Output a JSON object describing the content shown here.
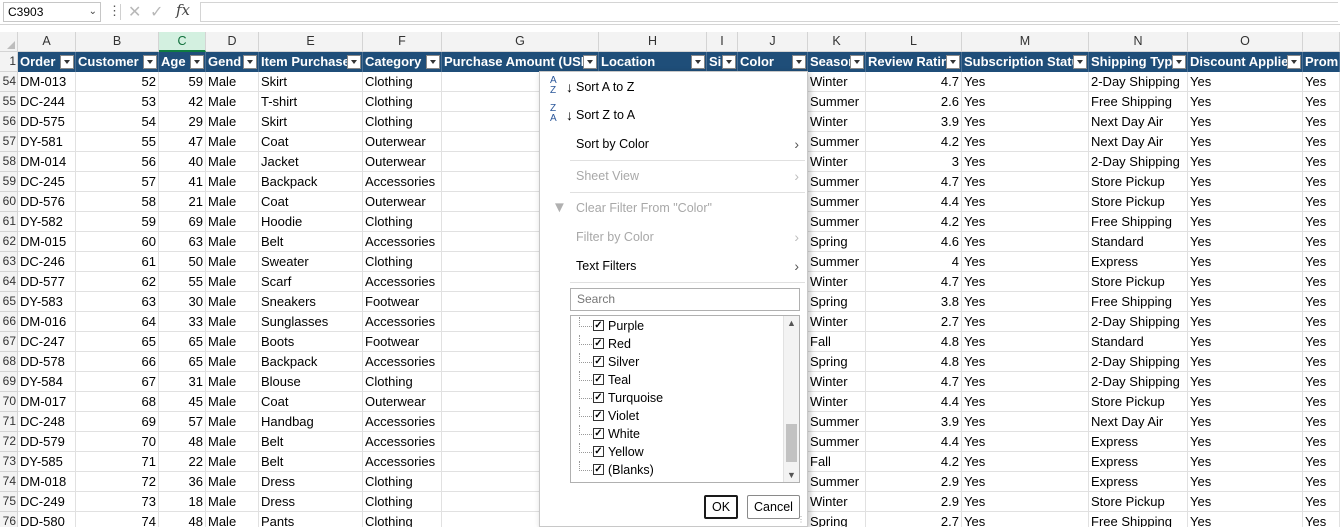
{
  "formula_bar": {
    "name_box": "C3903",
    "fx_label": "fx",
    "formula": ""
  },
  "columns": [
    "A",
    "B",
    "C",
    "D",
    "E",
    "F",
    "G",
    "H",
    "I",
    "J",
    "K",
    "L",
    "M",
    "N",
    "O",
    ""
  ],
  "selected_column": "C",
  "headers": [
    "Order",
    "Customer",
    "Age",
    "Gend",
    "Item Purchase",
    "Category",
    "Purchase Amount (USD)",
    "Location",
    "Si",
    "Color",
    "Season",
    "Review Rating",
    "Subscription Status",
    "Shipping Type",
    "Discount Applied",
    "Prom"
  ],
  "header_row_number": "1",
  "rows": [
    {
      "row": "54",
      "id": "DM-013",
      "cust": "52",
      "age": "59",
      "gender": "Male",
      "item": "Skirt",
      "category": "Clothing",
      "season": "Winter",
      "rating": "4.7",
      "sub": "Yes",
      "ship": "2-Day Shipping",
      "disc": "Yes",
      "promo": "Yes"
    },
    {
      "row": "55",
      "id": "DC-244",
      "cust": "53",
      "age": "42",
      "gender": "Male",
      "item": "T-shirt",
      "category": "Clothing",
      "season": "Summer",
      "rating": "2.6",
      "sub": "Yes",
      "ship": "Free Shipping",
      "disc": "Yes",
      "promo": "Yes"
    },
    {
      "row": "56",
      "id": "DD-575",
      "cust": "54",
      "age": "29",
      "gender": "Male",
      "item": "Skirt",
      "category": "Clothing",
      "season": "Winter",
      "rating": "3.9",
      "sub": "Yes",
      "ship": "Next Day Air",
      "disc": "Yes",
      "promo": "Yes"
    },
    {
      "row": "57",
      "id": "DY-581",
      "cust": "55",
      "age": "47",
      "gender": "Male",
      "item": "Coat",
      "category": "Outerwear",
      "season": "Summer",
      "rating": "4.2",
      "sub": "Yes",
      "ship": "Next Day Air",
      "disc": "Yes",
      "promo": "Yes"
    },
    {
      "row": "58",
      "id": "DM-014",
      "cust": "56",
      "age": "40",
      "gender": "Male",
      "item": "Jacket",
      "category": "Outerwear",
      "season": "Winter",
      "rating": "3",
      "sub": "Yes",
      "ship": "2-Day Shipping",
      "disc": "Yes",
      "promo": "Yes"
    },
    {
      "row": "59",
      "id": "DC-245",
      "cust": "57",
      "age": "41",
      "gender": "Male",
      "item": "Backpack",
      "category": "Accessories",
      "season": "Summer",
      "rating": "4.7",
      "sub": "Yes",
      "ship": "Store Pickup",
      "disc": "Yes",
      "promo": "Yes"
    },
    {
      "row": "60",
      "id": "DD-576",
      "cust": "58",
      "age": "21",
      "gender": "Male",
      "item": "Coat",
      "category": "Outerwear",
      "season": "Summer",
      "rating": "4.4",
      "sub": "Yes",
      "ship": "Store Pickup",
      "disc": "Yes",
      "promo": "Yes"
    },
    {
      "row": "61",
      "id": "DY-582",
      "cust": "59",
      "age": "69",
      "gender": "Male",
      "item": "Hoodie",
      "category": "Clothing",
      "season": "Summer",
      "rating": "4.2",
      "sub": "Yes",
      "ship": "Free Shipping",
      "disc": "Yes",
      "promo": "Yes"
    },
    {
      "row": "62",
      "id": "DM-015",
      "cust": "60",
      "age": "63",
      "gender": "Male",
      "item": "Belt",
      "category": "Accessories",
      "season": "Spring",
      "rating": "4.6",
      "sub": "Yes",
      "ship": "Standard",
      "disc": "Yes",
      "promo": "Yes"
    },
    {
      "row": "63",
      "id": "DC-246",
      "cust": "61",
      "age": "50",
      "gender": "Male",
      "item": "Sweater",
      "category": "Clothing",
      "season": "Summer",
      "rating": "4",
      "sub": "Yes",
      "ship": "Express",
      "disc": "Yes",
      "promo": "Yes"
    },
    {
      "row": "64",
      "id": "DD-577",
      "cust": "62",
      "age": "55",
      "gender": "Male",
      "item": "Scarf",
      "category": "Accessories",
      "season": "Winter",
      "rating": "4.7",
      "sub": "Yes",
      "ship": "Store Pickup",
      "disc": "Yes",
      "promo": "Yes"
    },
    {
      "row": "65",
      "id": "DY-583",
      "cust": "63",
      "age": "30",
      "gender": "Male",
      "item": "Sneakers",
      "category": "Footwear",
      "season": "Spring",
      "rating": "3.8",
      "sub": "Yes",
      "ship": "Free Shipping",
      "disc": "Yes",
      "promo": "Yes"
    },
    {
      "row": "66",
      "id": "DM-016",
      "cust": "64",
      "age": "33",
      "gender": "Male",
      "item": "Sunglasses",
      "category": "Accessories",
      "season": "Winter",
      "rating": "2.7",
      "sub": "Yes",
      "ship": "2-Day Shipping",
      "disc": "Yes",
      "promo": "Yes"
    },
    {
      "row": "67",
      "id": "DC-247",
      "cust": "65",
      "age": "65",
      "gender": "Male",
      "item": "Boots",
      "category": "Footwear",
      "season": "Fall",
      "rating": "4.8",
      "sub": "Yes",
      "ship": "Standard",
      "disc": "Yes",
      "promo": "Yes"
    },
    {
      "row": "68",
      "id": "DD-578",
      "cust": "66",
      "age": "65",
      "gender": "Male",
      "item": "Backpack",
      "category": "Accessories",
      "season": "Spring",
      "rating": "4.8",
      "sub": "Yes",
      "ship": "2-Day Shipping",
      "disc": "Yes",
      "promo": "Yes"
    },
    {
      "row": "69",
      "id": "DY-584",
      "cust": "67",
      "age": "31",
      "gender": "Male",
      "item": "Blouse",
      "category": "Clothing",
      "season": "Winter",
      "rating": "4.7",
      "sub": "Yes",
      "ship": "2-Day Shipping",
      "disc": "Yes",
      "promo": "Yes"
    },
    {
      "row": "70",
      "id": "DM-017",
      "cust": "68",
      "age": "45",
      "gender": "Male",
      "item": "Coat",
      "category": "Outerwear",
      "season": "Winter",
      "rating": "4.4",
      "sub": "Yes",
      "ship": "Store Pickup",
      "disc": "Yes",
      "promo": "Yes"
    },
    {
      "row": "71",
      "id": "DC-248",
      "cust": "69",
      "age": "57",
      "gender": "Male",
      "item": "Handbag",
      "category": "Accessories",
      "season": "Summer",
      "rating": "3.9",
      "sub": "Yes",
      "ship": "Next Day Air",
      "disc": "Yes",
      "promo": "Yes"
    },
    {
      "row": "72",
      "id": "DD-579",
      "cust": "70",
      "age": "48",
      "gender": "Male",
      "item": "Belt",
      "category": "Accessories",
      "season": "Summer",
      "rating": "4.4",
      "sub": "Yes",
      "ship": "Express",
      "disc": "Yes",
      "promo": "Yes"
    },
    {
      "row": "73",
      "id": "DY-585",
      "cust": "71",
      "age": "22",
      "gender": "Male",
      "item": "Belt",
      "category": "Accessories",
      "season": "Fall",
      "rating": "4.2",
      "sub": "Yes",
      "ship": "Express",
      "disc": "Yes",
      "promo": "Yes"
    },
    {
      "row": "74",
      "id": "DM-018",
      "cust": "72",
      "age": "36",
      "gender": "Male",
      "item": "Dress",
      "category": "Clothing",
      "season": "Summer",
      "rating": "2.9",
      "sub": "Yes",
      "ship": "Express",
      "disc": "Yes",
      "promo": "Yes"
    },
    {
      "row": "75",
      "id": "DC-249",
      "cust": "73",
      "age": "18",
      "gender": "Male",
      "item": "Dress",
      "category": "Clothing",
      "season": "Winter",
      "rating": "2.9",
      "sub": "Yes",
      "ship": "Store Pickup",
      "disc": "Yes",
      "promo": "Yes"
    },
    {
      "row": "76",
      "id": "DD-580",
      "cust": "74",
      "age": "48",
      "gender": "Male",
      "item": "Pants",
      "category": "Clothing",
      "season": "Spring",
      "rating": "2.7",
      "sub": "Yes",
      "ship": "Free Shipping",
      "disc": "Yes",
      "promo": "Yes"
    }
  ],
  "filter_menu": {
    "sort_az": "Sort A to Z",
    "sort_za": "Sort Z to A",
    "sort_by_color": "Sort by Color",
    "sheet_view": "Sheet View",
    "clear_filter": "Clear Filter From \"Color\"",
    "filter_by_color": "Filter by Color",
    "text_filters": "Text Filters",
    "search_placeholder": "Search",
    "items": [
      {
        "label": "Purple",
        "checked": true
      },
      {
        "label": "Red",
        "checked": true
      },
      {
        "label": "Silver",
        "checked": true
      },
      {
        "label": "Teal",
        "checked": true
      },
      {
        "label": "Turquoise",
        "checked": true
      },
      {
        "label": "Violet",
        "checked": true
      },
      {
        "label": "White",
        "checked": true
      },
      {
        "label": "Yellow",
        "checked": true
      },
      {
        "label": "(Blanks)",
        "checked": true
      }
    ],
    "ok": "OK",
    "cancel": "Cancel"
  },
  "colors": {
    "header_bg": "#1f4e79",
    "selected_col": "#107c41"
  }
}
